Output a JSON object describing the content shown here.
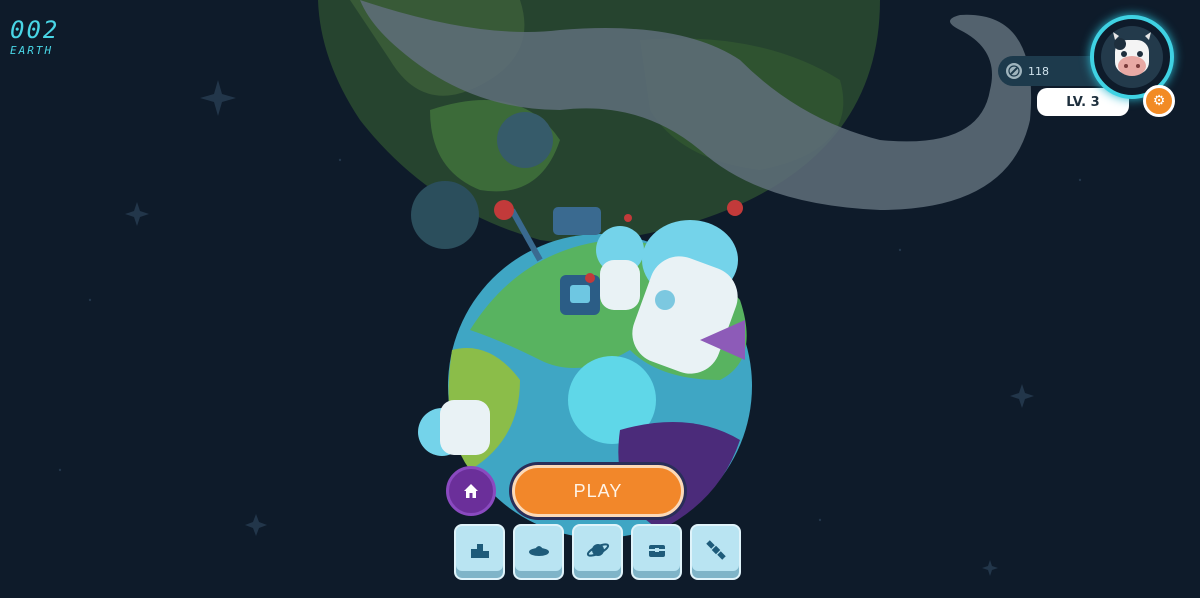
{
  "planet": {
    "number": "002",
    "name": "EARTH"
  },
  "profile": {
    "coins": "118",
    "level": "LV. 3"
  },
  "play": {
    "label": "PLAY"
  },
  "colors": {
    "accent": "#49d6e6",
    "play": "#f2872a",
    "home": "#6b2f9a",
    "background": "#0e1b2a"
  },
  "icons": {
    "home": "home-icon",
    "settings": "gear-icon",
    "coin": "coin-icon",
    "toolbar": [
      "leaderboard-icon",
      "ufo-icon",
      "planet-icon",
      "chest-icon",
      "satellite-icon"
    ]
  }
}
